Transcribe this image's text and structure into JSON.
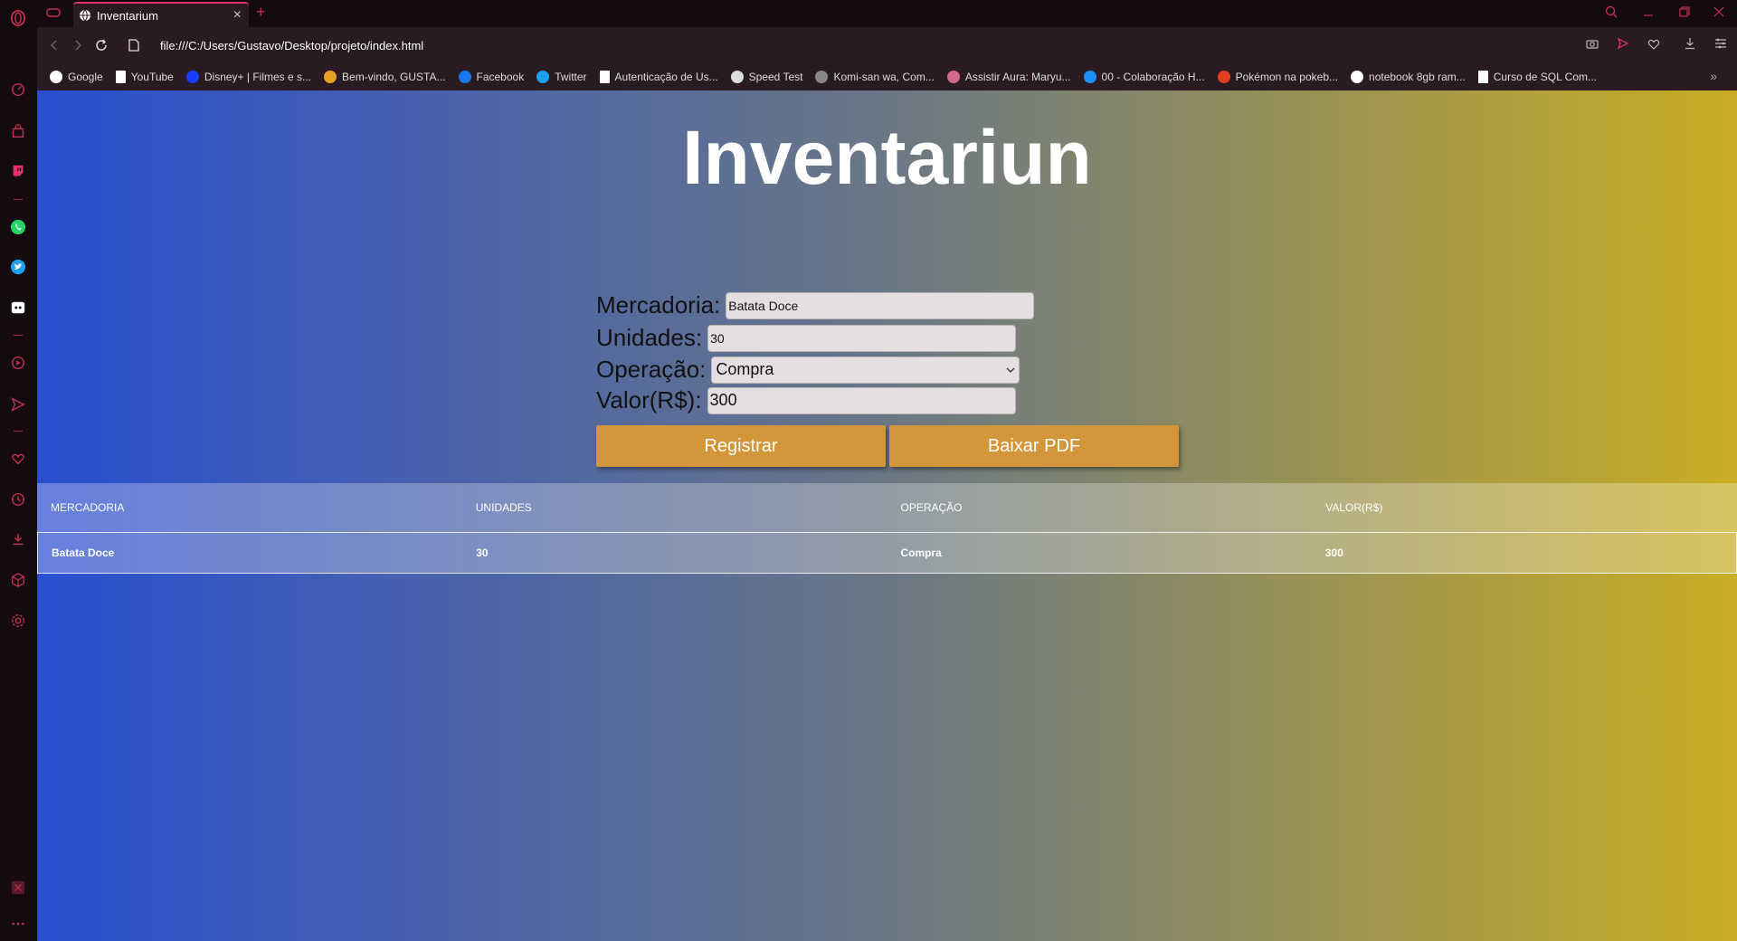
{
  "browser": {
    "tab_title": "Inventarium",
    "url": "file:///C:/Users/Gustavo/Desktop/projeto/index.html",
    "accent_color": "#e8306b"
  },
  "bookmarks": [
    {
      "label": "Google",
      "icon": "google-icon",
      "color": "#ffffff"
    },
    {
      "label": "YouTube",
      "icon": "page-icon",
      "color": "#ffffff"
    },
    {
      "label": "Disney+ | Filmes e s...",
      "icon": "disney-icon",
      "color": "#1a3cff"
    },
    {
      "label": "Bem-vindo, GUSTA...",
      "icon": "colorful-icon",
      "color": "#e8a020"
    },
    {
      "label": "Facebook",
      "icon": "facebook-icon",
      "color": "#1877f2"
    },
    {
      "label": "Twitter",
      "icon": "twitter-icon",
      "color": "#1da1f2"
    },
    {
      "label": "Autenticação de Us...",
      "icon": "page-icon",
      "color": "#ffffff"
    },
    {
      "label": "Speed Test",
      "icon": "speedtest-icon",
      "color": "#dddddd"
    },
    {
      "label": "Komi-san wa, Com...",
      "icon": "tv-icon",
      "color": "#888888"
    },
    {
      "label": "Assistir Aura: Maryu...",
      "icon": "avatar-icon",
      "color": "#d46a8a"
    },
    {
      "label": "00 - Colaboração H...",
      "icon": "onedrive-icon",
      "color": "#1e90ff"
    },
    {
      "label": "Pokémon na pokeb...",
      "icon": "pokeball-icon",
      "color": "#e04020"
    },
    {
      "label": "notebook 8gb ram...",
      "icon": "google-icon",
      "color": "#ffffff"
    },
    {
      "label": "Curso de SQL Com...",
      "icon": "page-icon",
      "color": "#ffffff"
    }
  ],
  "page": {
    "title": "Inventariun",
    "form": {
      "mercadoria_label": "Mercadoria:",
      "mercadoria_value": "Batata Doce",
      "unidades_label": "Unidades:",
      "unidades_value": "30",
      "operacao_label": "Operação:",
      "operacao_value": "Compra",
      "valor_label": "Valor(R$):",
      "valor_value": "300"
    },
    "buttons": {
      "registrar": "Registrar",
      "baixar_pdf": "Baixar PDF"
    },
    "table": {
      "headers": [
        "MERCADORIA",
        "UNIDADES",
        "OPERAÇÃO",
        "VALOR(R$)"
      ],
      "rows": [
        [
          "Batata Doce",
          "30",
          "Compra",
          "300"
        ]
      ]
    }
  }
}
